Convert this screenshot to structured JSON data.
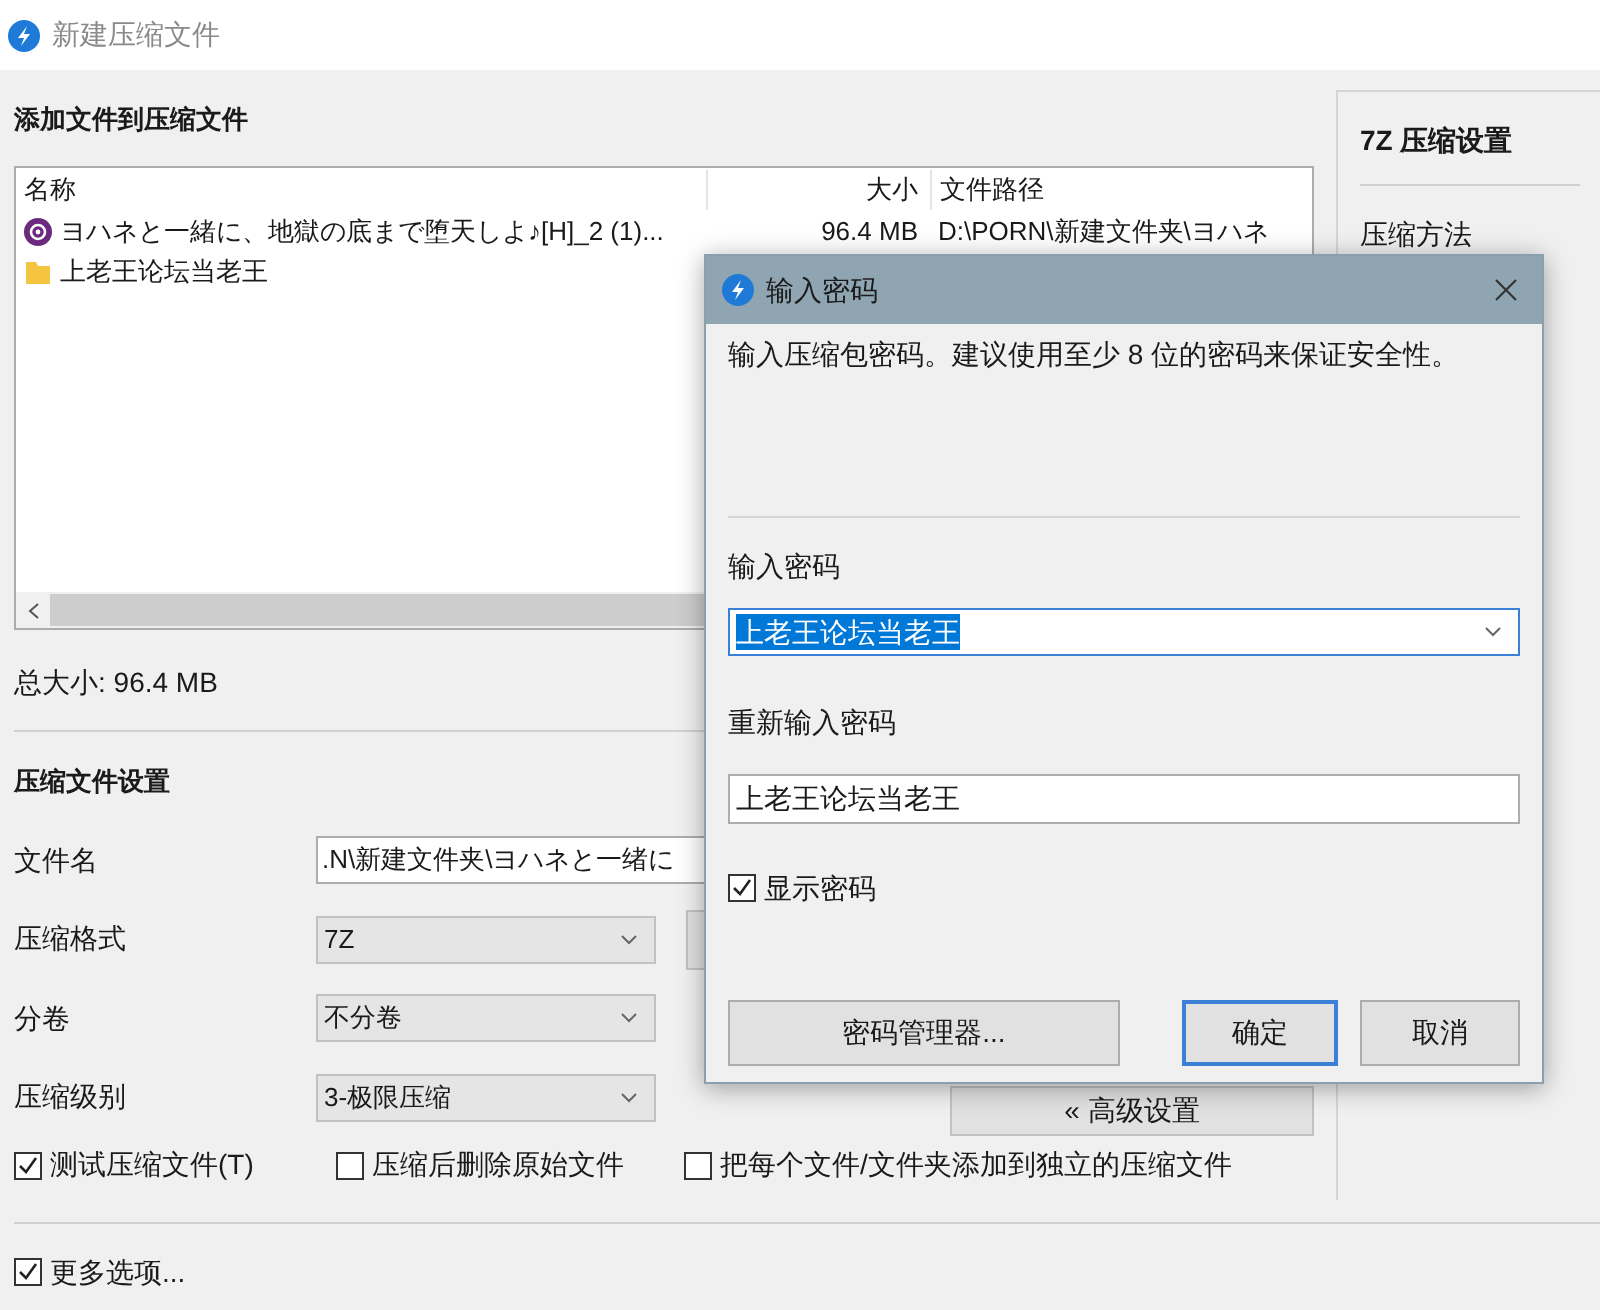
{
  "window": {
    "title": "新建压缩文件"
  },
  "add_files": {
    "heading": "添加文件到压缩文件",
    "columns": [
      "名称",
      "大小",
      "文件路径"
    ],
    "rows": [
      {
        "kind": "video",
        "name": "ヨハネと一緒に、地獄の底まで堕天しよ♪[H]_2 (1)...",
        "size": "96.4 MB",
        "path": "D:\\PORN\\新建文件夹\\ヨハネ"
      },
      {
        "kind": "folder",
        "name": "上老王论坛当老王"
      }
    ],
    "total": "总大小: 96.4 MB"
  },
  "archive_settings": {
    "heading": "压缩文件设置",
    "fields": [
      {
        "label": "文件名",
        "kind": "text",
        "value": ".N\\新建文件夹\\ヨハネと一绪に"
      },
      {
        "label": "压缩格式",
        "kind": "select",
        "value": "7Z"
      },
      {
        "label": "分卷",
        "kind": "select",
        "value": "不分卷"
      },
      {
        "label": "压缩级别",
        "kind": "select",
        "value": "3-极限压缩"
      }
    ],
    "advanced_button": "« 高级设置",
    "options": [
      {
        "label": "测试压缩文件(T)",
        "checked": true
      },
      {
        "label": "压缩后删除原始文件",
        "checked": false
      },
      {
        "label": "把每个文件/文件夹添加到独立的压缩文件",
        "checked": false
      }
    ],
    "more_options": {
      "label": "更多选项...",
      "checked": true
    }
  },
  "side_panel": {
    "heading": "7Z 压缩设置",
    "items": [
      "压缩方法"
    ]
  },
  "dialog": {
    "title": "输入密码",
    "description": "输入压缩包密码。建议使用至少 8 位的密码来保证安全性。",
    "password": {
      "label": "输入密码",
      "value": "上老王论坛当老王",
      "text_selected": true
    },
    "confirm": {
      "label": "重新输入密码",
      "value": "上老王论坛当老王"
    },
    "show_password": {
      "label": "显示密码",
      "checked": true
    },
    "buttons": [
      {
        "label": "密码管理器...",
        "default": false
      },
      {
        "label": "确定",
        "default": true
      },
      {
        "label": "取消",
        "default": false
      }
    ]
  }
}
